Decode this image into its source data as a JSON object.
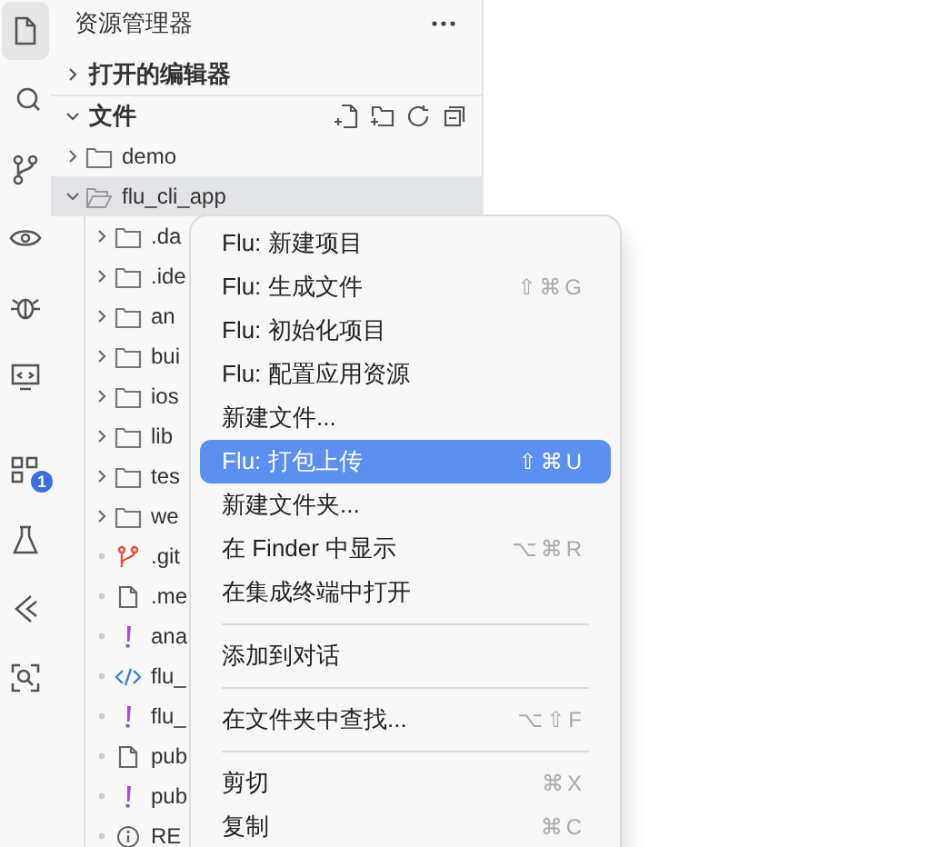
{
  "activity_bar": {
    "items": [
      {
        "kind": "files",
        "selected": true
      },
      {
        "kind": "search",
        "selected": false
      },
      {
        "kind": "source-control",
        "selected": false
      },
      {
        "kind": "eye",
        "selected": false
      },
      {
        "kind": "bug",
        "selected": false
      },
      {
        "kind": "monitor",
        "selected": false
      },
      {
        "kind": "extensions",
        "selected": false,
        "badge": "1"
      },
      {
        "kind": "flask",
        "selected": false
      },
      {
        "kind": "chevrons",
        "selected": false
      },
      {
        "kind": "scan",
        "selected": false
      }
    ]
  },
  "sidebar": {
    "title": "资源管理器",
    "sections": [
      {
        "label": "打开的编辑器",
        "expanded": false
      },
      {
        "label": "文件",
        "expanded": true
      }
    ],
    "tree": [
      {
        "name": "demo",
        "kind": "folder",
        "expanded": false,
        "selected": false
      },
      {
        "name": "flu_cli_app",
        "kind": "folder",
        "expanded": true,
        "selected": true,
        "children": [
          {
            "name": ".da",
            "kind": "folder",
            "expanded": false,
            "selected": false
          },
          {
            "name": ".ide",
            "kind": "folder",
            "expanded": false,
            "selected": false
          },
          {
            "name": "an",
            "kind": "folder",
            "expanded": false,
            "selected": false
          },
          {
            "name": "bui",
            "kind": "folder",
            "expanded": false,
            "selected": false
          },
          {
            "name": "ios",
            "kind": "folder",
            "expanded": false,
            "selected": false
          },
          {
            "name": "lib",
            "kind": "folder",
            "expanded": false,
            "selected": false
          },
          {
            "name": "tes",
            "kind": "folder",
            "expanded": false,
            "selected": false
          },
          {
            "name": "we",
            "kind": "folder",
            "expanded": false,
            "selected": false
          },
          {
            "name": ".git",
            "kind": "git",
            "selected": false
          },
          {
            "name": ".me",
            "kind": "file",
            "selected": false
          },
          {
            "name": "ana",
            "kind": "yaml",
            "selected": false
          },
          {
            "name": "flu_",
            "kind": "code",
            "selected": false
          },
          {
            "name": "flu_",
            "kind": "yaml",
            "selected": false
          },
          {
            "name": "pub",
            "kind": "file",
            "selected": false
          },
          {
            "name": "pub",
            "kind": "yaml",
            "selected": false
          },
          {
            "name": "RE",
            "kind": "info",
            "selected": false
          }
        ]
      }
    ]
  },
  "context_menu": {
    "items": [
      {
        "kind": "item",
        "label": "Flu: 新建项目",
        "selected": false
      },
      {
        "kind": "item",
        "label": "Flu: 生成文件",
        "shortcut": "⇧⌘G",
        "selected": false
      },
      {
        "kind": "item",
        "label": "Flu: 初始化项目",
        "selected": false
      },
      {
        "kind": "item",
        "label": "Flu: 配置应用资源",
        "selected": false
      },
      {
        "kind": "item",
        "label": "新建文件...",
        "selected": false
      },
      {
        "kind": "item",
        "label": "Flu: 打包上传",
        "shortcut": "⇧⌘U",
        "selected": true
      },
      {
        "kind": "item",
        "label": "新建文件夹...",
        "selected": false
      },
      {
        "kind": "item",
        "label": "在 Finder 中显示",
        "shortcut": "⌥⌘R",
        "selected": false
      },
      {
        "kind": "item",
        "label": "在集成终端中打开",
        "selected": false
      },
      {
        "kind": "separator"
      },
      {
        "kind": "item",
        "label": "添加到对话",
        "selected": false
      },
      {
        "kind": "separator"
      },
      {
        "kind": "item",
        "label": "在文件夹中查找...",
        "shortcut": "⌥⇧F",
        "selected": false
      },
      {
        "kind": "separator"
      },
      {
        "kind": "item",
        "label": "剪切",
        "shortcut": "⌘X",
        "selected": false
      },
      {
        "kind": "item",
        "label": "复制",
        "shortcut": "⌘C",
        "selected": false
      }
    ]
  }
}
